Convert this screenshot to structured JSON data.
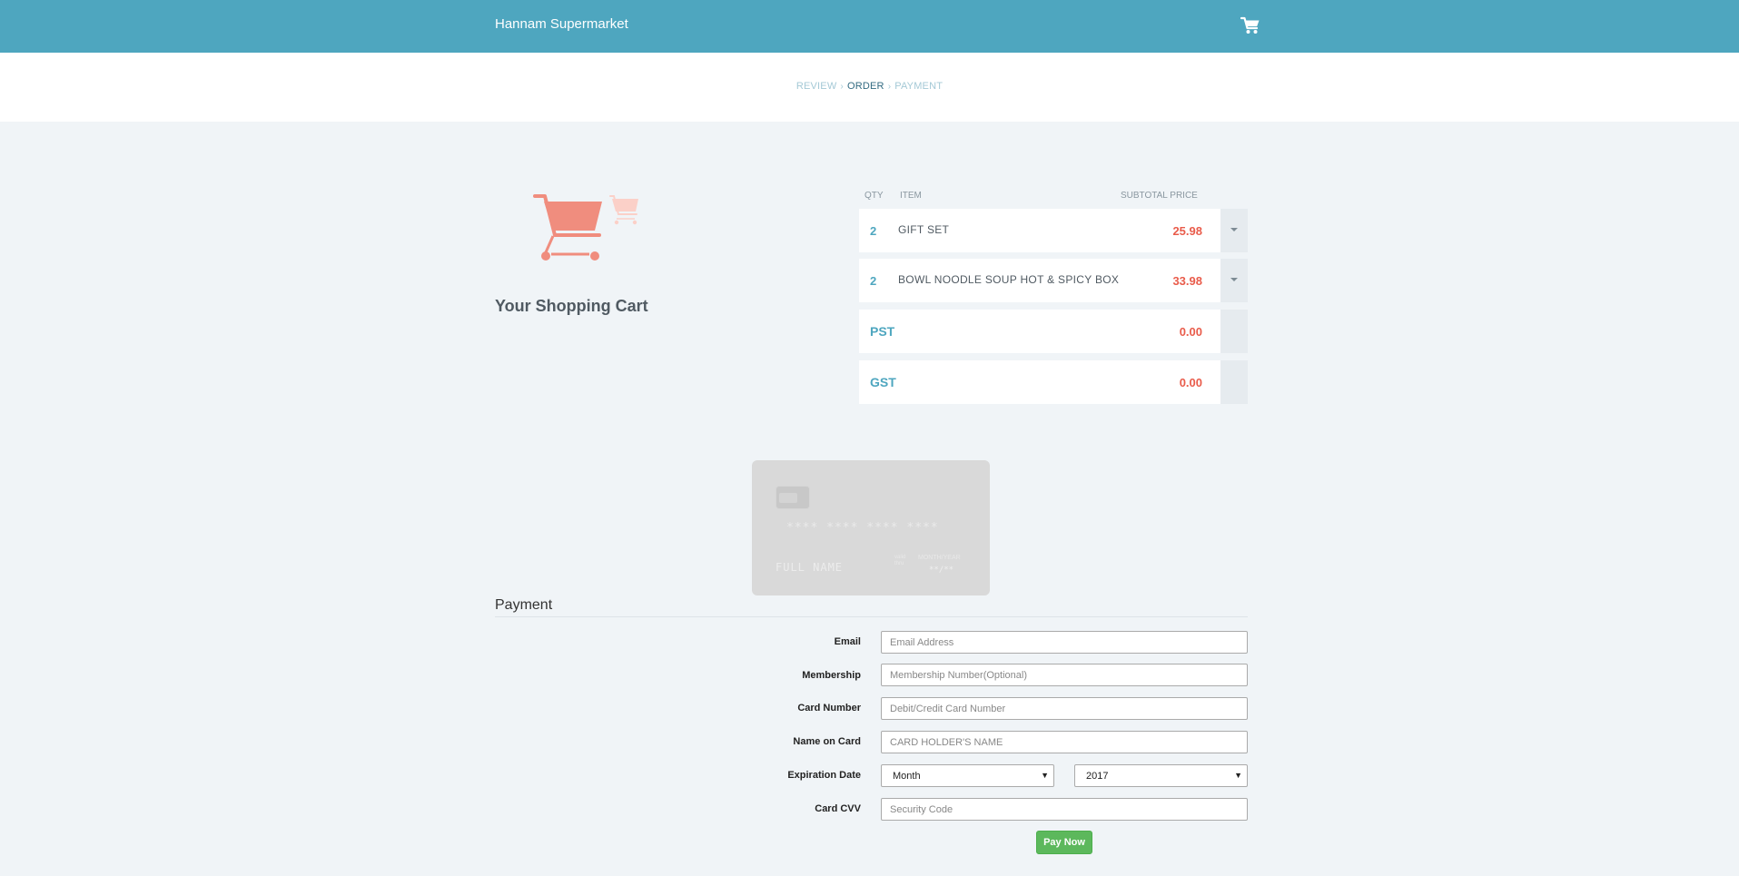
{
  "header": {
    "brand": "Hannam Supermarket",
    "cart_icon": "shopping-cart-icon"
  },
  "steps": [
    {
      "label": "REVIEW",
      "active": false
    },
    {
      "label": "ORDER",
      "active": true
    },
    {
      "label": "PAYMENT",
      "active": false
    }
  ],
  "cart": {
    "title": "Your Shopping Cart",
    "illustration": "shopping-cart-icon",
    "columns": {
      "qty": "QTY",
      "item": "ITEM",
      "subtotal": "SUBTOTAL PRICE"
    },
    "items": [
      {
        "qty": "2",
        "name": "GIFT SET",
        "price": "25.98"
      },
      {
        "qty": "2",
        "name": "BOWL NOODLE SOUP HOT & SPICY BOX",
        "price": "33.98"
      }
    ],
    "taxes": [
      {
        "label": "PST",
        "amount": "0.00"
      },
      {
        "label": "GST",
        "amount": "0.00"
      }
    ]
  },
  "card_preview": {
    "number": "**** **** **** ****",
    "name": "FULL NAME",
    "valid_label": "valid\nthru",
    "month_year": "MONTH/YEAR",
    "expiry": "**/**"
  },
  "payment": {
    "title": "Payment",
    "fields": {
      "email": {
        "label": "Email",
        "placeholder": "Email Address",
        "value": ""
      },
      "membership": {
        "label": "Membership",
        "placeholder": "Membership Number(Optional)",
        "value": ""
      },
      "card_number": {
        "label": "Card Number",
        "placeholder": "Debit/Credit Card Number",
        "value": ""
      },
      "name_on_card": {
        "label": "Name on Card",
        "placeholder": "CARD HOLDER'S NAME",
        "value": ""
      },
      "expiration": {
        "label": "Expiration Date",
        "month": "Month",
        "year": "2017"
      },
      "cvv": {
        "label": "Card CVV",
        "placeholder": "Security Code",
        "value": ""
      }
    },
    "submit_label": "Pay Now"
  },
  "colors": {
    "header_bg": "#4ea6bf",
    "page_bg": "#f0f4f7",
    "price": "#e95c4b",
    "qty": "#4ea6bf",
    "cart_illustration": "#f08d7e",
    "pay_button": "#5cb85c"
  }
}
